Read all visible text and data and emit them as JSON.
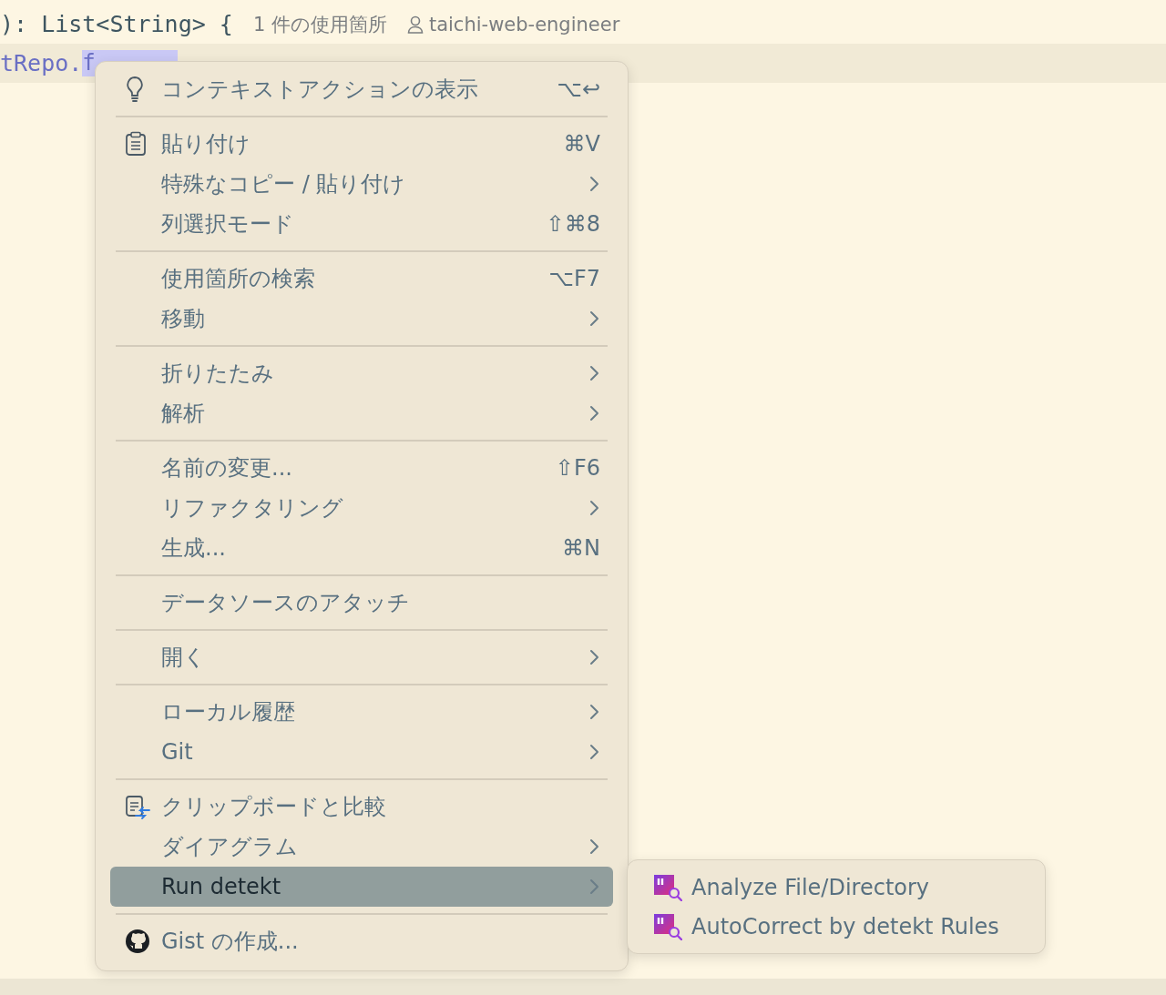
{
  "editor": {
    "lines": [
      {
        "code": "): List<String> {",
        "usages": "1 件の使用箇所",
        "author": "taichi-web-engineer",
        "current": false
      },
      {
        "code": "tRepo.",
        "highlight": "f",
        "current": true
      }
    ]
  },
  "context_menu": {
    "sections": [
      [
        {
          "label": "コンテキストアクションの表示",
          "shortcut": "⌥↩",
          "kind": "lightbulb",
          "submenu": false,
          "selected": false
        }
      ],
      [
        {
          "label": "貼り付け",
          "shortcut": "⌘V",
          "kind": "clipboard",
          "submenu": false,
          "selected": false
        },
        {
          "label": "特殊なコピー / 貼り付け",
          "submenu": true,
          "selected": false
        },
        {
          "label": "列選択モード",
          "shortcut": "⇧⌘8",
          "submenu": false,
          "selected": false
        }
      ],
      [
        {
          "label": "使用箇所の検索",
          "shortcut": "⌥F7",
          "submenu": false,
          "selected": false
        },
        {
          "label": "移動",
          "submenu": true,
          "selected": false
        }
      ],
      [
        {
          "label": "折りたたみ",
          "submenu": true,
          "selected": false
        },
        {
          "label": "解析",
          "submenu": true,
          "selected": false
        }
      ],
      [
        {
          "label": "名前の変更...",
          "shortcut": "⇧F6",
          "submenu": false,
          "selected": false
        },
        {
          "label": "リファクタリング",
          "submenu": true,
          "selected": false
        },
        {
          "label": "生成...",
          "shortcut": "⌘N",
          "submenu": false,
          "selected": false
        }
      ],
      [
        {
          "label": "データソースのアタッチ",
          "submenu": false,
          "selected": false
        }
      ],
      [
        {
          "label": "開く",
          "submenu": true,
          "selected": false
        }
      ],
      [
        {
          "label": "ローカル履歴",
          "submenu": true,
          "selected": false
        },
        {
          "label": "Git",
          "submenu": true,
          "selected": false
        }
      ],
      [
        {
          "label": "クリップボードと比較",
          "kind": "compare",
          "submenu": false,
          "selected": false
        },
        {
          "label": "ダイアグラム",
          "submenu": true,
          "selected": false
        },
        {
          "label": "Run detekt",
          "submenu": true,
          "selected": true
        }
      ],
      [
        {
          "label": "Gist の作成...",
          "kind": "github",
          "submenu": false,
          "selected": false
        }
      ]
    ]
  },
  "submenu": {
    "items": [
      {
        "label": "Analyze File/Directory",
        "kind": "detekt"
      },
      {
        "label": "AutoCorrect by detekt Rules",
        "kind": "detekt"
      }
    ]
  }
}
